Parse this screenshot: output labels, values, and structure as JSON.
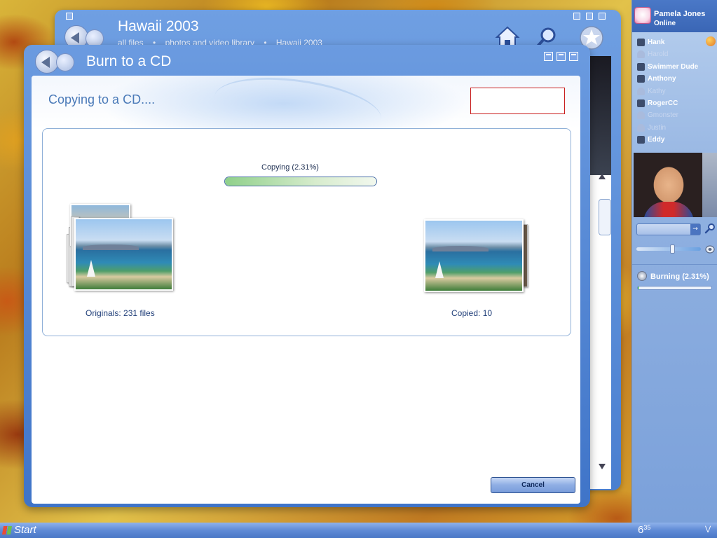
{
  "back_window": {
    "title": "Hawaii 2003",
    "breadcrumbs": [
      "all files",
      "•",
      "photos and video library",
      "•",
      "Hawaii 2003"
    ]
  },
  "dialog": {
    "title": "Burn to a CD",
    "heading": "Copying to a CD....",
    "progress": {
      "label": "Copying  (2.31%)",
      "percent": 2.31
    },
    "originals_caption": "Originals: 231 files",
    "copied_caption": "Copied: 10",
    "cancel_label": "Cancel"
  },
  "sidebar": {
    "user_name": "Pamela Jones",
    "user_status": "Online",
    "contacts": [
      {
        "name": "Hank",
        "online": true
      },
      {
        "name": "Harold",
        "online": false
      },
      {
        "name": "Swimmer Dude",
        "online": true
      },
      {
        "name": "Anthony",
        "online": true
      },
      {
        "name": "Kathy",
        "online": false
      },
      {
        "name": "RogerCC",
        "online": true
      },
      {
        "name": "Gmonster",
        "online": false
      },
      {
        "name": "Justin",
        "online": false
      },
      {
        "name": "Eddy",
        "online": true
      }
    ],
    "burn_status": "Burning (2.31%)",
    "burn_percent": 2.31,
    "volume_level": 0.55
  },
  "taskbar": {
    "start_label": "Start",
    "clock_hour": "6",
    "clock_minutes": "35"
  }
}
